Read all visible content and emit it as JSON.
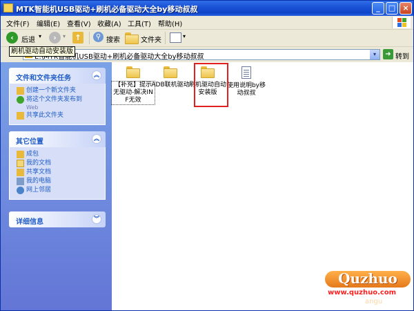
{
  "window": {
    "title": "MTK智能机USB驱动+刷机必备驱动大全by移动叔叔",
    "minimize_glyph": "_",
    "maximize_glyph": "□",
    "close_glyph": "×"
  },
  "menu": [
    "文件(F)",
    "编辑(E)",
    "查看(V)",
    "收藏(A)",
    "工具(T)",
    "帮助(H)"
  ],
  "toolbar": {
    "back_label": "后退",
    "search_label": "搜索",
    "folders_label": "文件夹"
  },
  "tooltip": "刷机驱动自动安装版",
  "address": {
    "path": "E:\\MTK智能机USB驱动+刷机必备驱动大全by移动叔叔",
    "go_label": "转到",
    "dropdown_glyph": "▾"
  },
  "taskpane": {
    "file_tasks": {
      "title": "文件和文件夹任务",
      "items": [
        "创建一个新文件夹",
        "将这个文件夹发布到",
        "Web",
        "共享此文件夹"
      ]
    },
    "other_places": {
      "title": "其它位置",
      "items": [
        "成包",
        "我的文档",
        "共享文档",
        "我的电脑",
        "网上邻居"
      ]
    },
    "details": {
      "title": "详细信息"
    },
    "chevron_glyph": "︽",
    "chevron_down_glyph": "︾"
  },
  "files": [
    {
      "name": "【补充】提示无驱动-解决INF无效",
      "type": "folder"
    },
    {
      "name": "ADB联机驱动",
      "type": "folder"
    },
    {
      "name": "刷机驱动自动安装版",
      "type": "folder"
    },
    {
      "name": "使用说明by移动叔叔",
      "type": "document"
    }
  ],
  "watermark": {
    "brand": "Quzhuo",
    "url": "www.quzhuo.com",
    "sub": "angu"
  },
  "colors": {
    "highlight": "#e01f1f",
    "taskpane_link": "#215dc6"
  }
}
